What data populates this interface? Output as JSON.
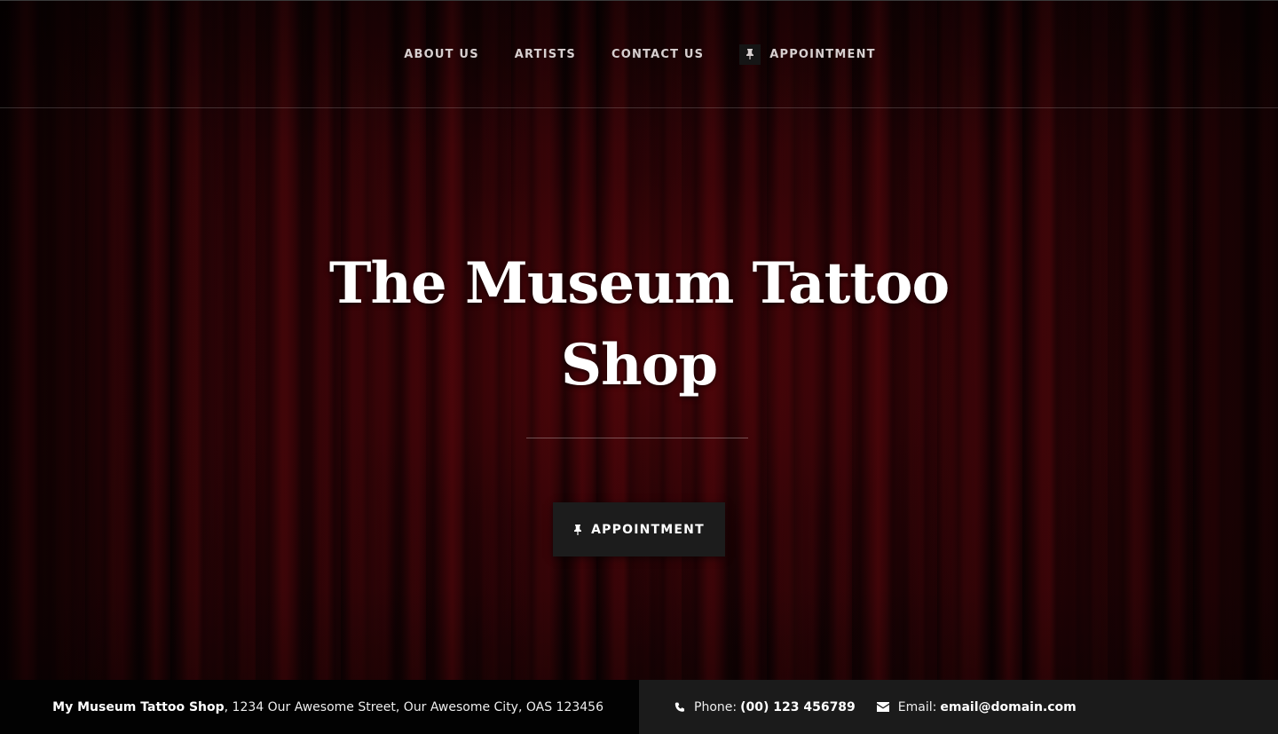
{
  "nav": {
    "items": [
      {
        "label": "ABOUT US"
      },
      {
        "label": "ARTISTS"
      },
      {
        "label": "CONTACT US"
      },
      {
        "label": "APPOINTMENT",
        "icon": "pin-icon"
      }
    ]
  },
  "hero": {
    "title_line1": "The Museum Tattoo",
    "title_line2": "Shop",
    "button_label": "APPOINTMENT",
    "button_icon": "pin-icon"
  },
  "footer": {
    "shop_name": "My Museum Tattoo Shop",
    "address": ", 1234 Our Awesome Street, Our Awesome City, OAS 123456",
    "phone_label": "Phone:",
    "phone_value": "(00) 123 456789",
    "phone_icon": "phone-icon",
    "email_label": "Email:",
    "email_value": "email@domain.com",
    "email_icon": "envelope-icon"
  },
  "colors": {
    "background": "#2a0306",
    "button_bg": "#1c1c1c",
    "footer_left_bg": "#020202",
    "footer_right_bg": "#1b1b1b"
  }
}
